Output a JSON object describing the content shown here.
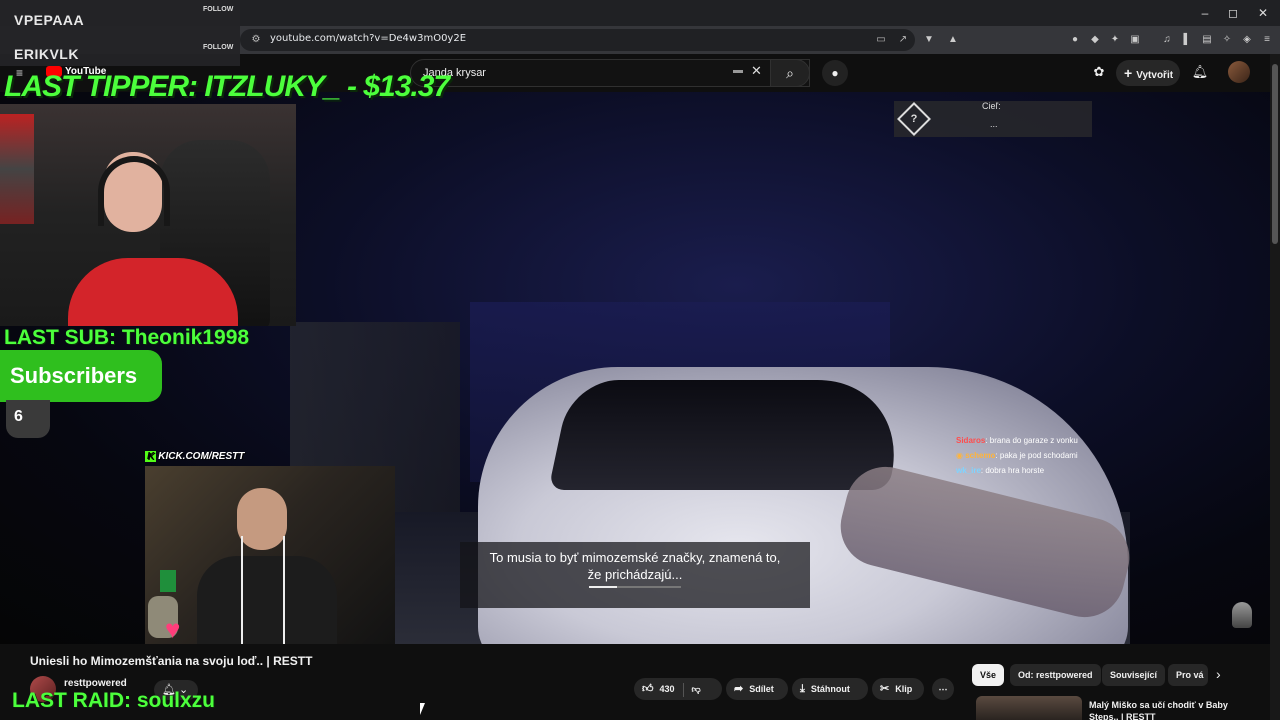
{
  "browser": {
    "url": "youtube.com/watch?v=De4w3mO0y2E",
    "window_controls": [
      "–",
      "◻",
      "✕"
    ]
  },
  "youtube_header": {
    "search_value": "Janda krysar",
    "create_label": "Vytvořit",
    "logo_text": "YouTube"
  },
  "stream_overlay": {
    "followers": [
      {
        "name": "VPEPAAA",
        "tag": "FOLLOW"
      },
      {
        "name": "ERIKVLK",
        "tag": "FOLLOW"
      }
    ],
    "last_tipper": "LAST TIPPER: ITZLUKY_ - $13.37",
    "last_sub": "LAST SUB: Theonik1998",
    "subscribers_label": "Subscribers",
    "subscribers_count": "6",
    "kick_label": "KICK.COM/RESTT",
    "last_raid": "LAST RAID: soulxzu"
  },
  "game": {
    "objective_title": "Cieľ:",
    "objective_value": "...",
    "objective_icon": "?",
    "chat": [
      {
        "user": "Sidaros",
        "message": ": brana do garaze z vonku",
        "color": "#ff4d4d"
      },
      {
        "user": "schemo",
        "message": ": paka je pod schodami",
        "color": "#ffb43a"
      },
      {
        "user": "wk_ire",
        "message": ": dobra hra horste",
        "color": "#7fd4ff"
      }
    ],
    "subtitle_line1": "To musia to byť mimozemské značky, znamená to,",
    "subtitle_line2": "že prichádzajú...",
    "subtitle_progress": 0.3
  },
  "video_info": {
    "title": "Uniesli ho Mimozemšťania na svoju loď.. | RESTT",
    "channel": "resttpowered",
    "likes": "430",
    "share_label": "Sdílet",
    "download_label": "Stáhnout",
    "clip_label": "Klip",
    "more_label": "⋯"
  },
  "chips": [
    "Vše",
    "Od: resttpowered",
    "Související",
    "Pro vá"
  ],
  "related": {
    "title": "Malý Miško sa učí chodiť v Baby Steps.. | RESTT"
  }
}
